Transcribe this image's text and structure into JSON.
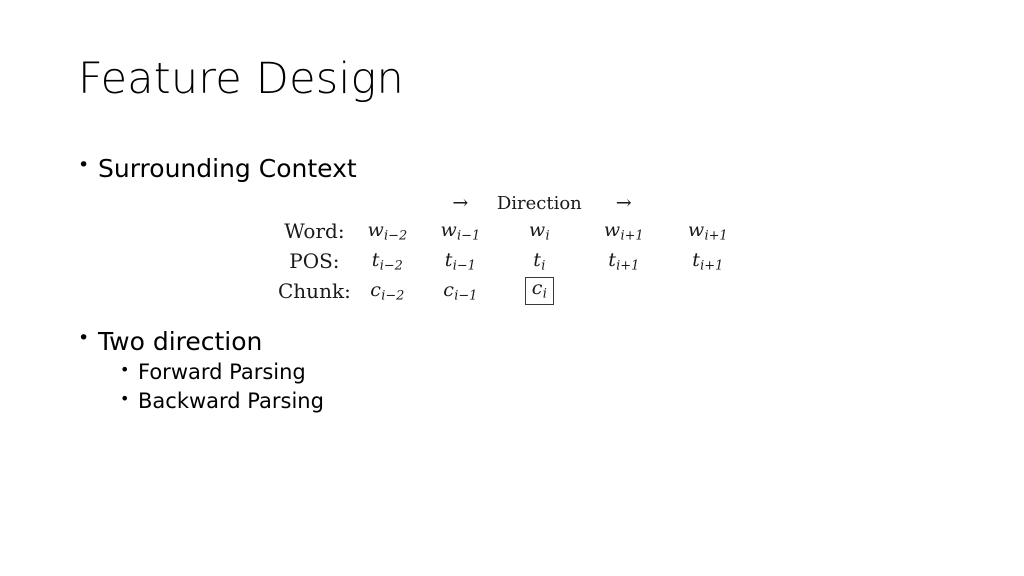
{
  "slide": {
    "title": "Feature Design",
    "bullets": [
      {
        "label": "Surrounding Context",
        "marker": "•",
        "children": []
      },
      {
        "label": "Two direction",
        "marker": "•",
        "children": [
          {
            "label": "Forward Parsing",
            "marker": "•"
          },
          {
            "label": "Backward Parsing",
            "marker": "•"
          }
        ]
      }
    ]
  },
  "figure": {
    "name": "surrounding-context-table",
    "header": {
      "left_arrow": "→",
      "direction_label": "Direction",
      "right_arrow": "→"
    },
    "row_labels": [
      "Word:",
      "POS:",
      "Chunk:"
    ],
    "rows": [
      {
        "label": "Word:",
        "cells": [
          {
            "base": "w",
            "sub": "i−2",
            "boxed": false
          },
          {
            "base": "w",
            "sub": "i−1",
            "boxed": false
          },
          {
            "base": "w",
            "sub": "i",
            "boxed": false
          },
          {
            "base": "w",
            "sub": "i+1",
            "boxed": false
          },
          {
            "base": "w",
            "sub": "i+1",
            "boxed": false
          }
        ]
      },
      {
        "label": "POS:",
        "cells": [
          {
            "base": "t",
            "sub": "i−2",
            "boxed": false
          },
          {
            "base": "t",
            "sub": "i−1",
            "boxed": false
          },
          {
            "base": "t",
            "sub": "i",
            "boxed": false
          },
          {
            "base": "t",
            "sub": "i+1",
            "boxed": false
          },
          {
            "base": "t",
            "sub": "i+1",
            "boxed": false
          }
        ]
      },
      {
        "label": "Chunk:",
        "cells": [
          {
            "base": "c",
            "sub": "i−2",
            "boxed": false
          },
          {
            "base": "c",
            "sub": "i−1",
            "boxed": false
          },
          {
            "base": "c",
            "sub": "i",
            "boxed": true
          },
          {
            "base": "",
            "sub": "",
            "boxed": false
          },
          {
            "base": "",
            "sub": "",
            "boxed": false
          }
        ]
      }
    ]
  },
  "colors": {
    "background": "#ffffff",
    "text": "#000000",
    "figure_text": "#1a1a1a",
    "box_border": "#3a3a3a"
  }
}
